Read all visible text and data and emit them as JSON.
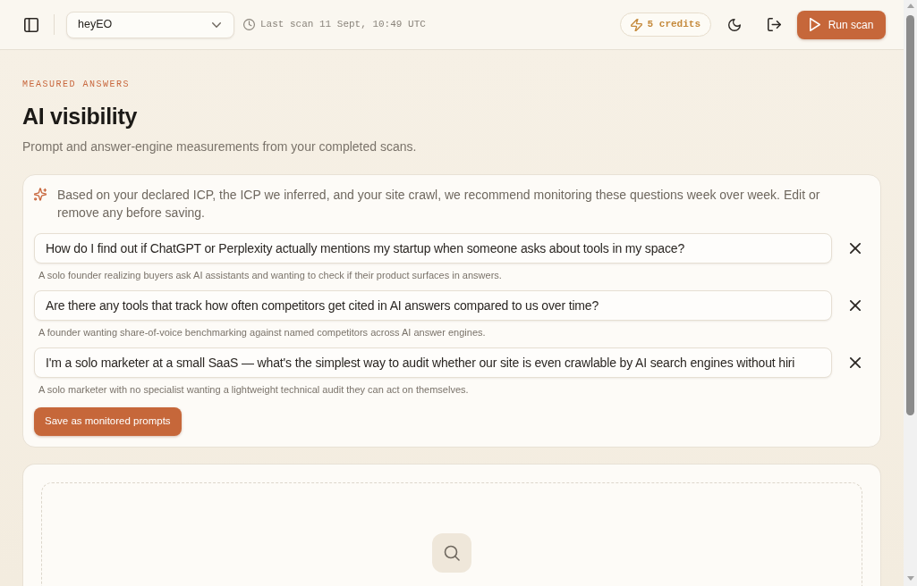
{
  "topbar": {
    "workspace": "heyEO",
    "last_scan": "Last scan 11 Sept, 10:49 UTC",
    "credits": "5 credits",
    "run_button": "Run scan"
  },
  "header": {
    "eyebrow": "MEASURED ANSWERS",
    "title": "AI visibility",
    "subtitle": "Prompt and answer-engine measurements from your completed scans."
  },
  "recommendations": {
    "intro": "Based on your declared ICP, the ICP we inferred, and your site crawl, we recommend monitoring these questions week over week. Edit or remove any before saving.",
    "prompts": [
      {
        "value": "How do I find out if ChatGPT or Perplexity actually mentions my startup when someone asks about tools in my space?",
        "hint": "A solo founder realizing buyers ask AI assistants and wanting to check if their product surfaces in answers."
      },
      {
        "value": "Are there any tools that track how often competitors get cited in AI answers compared to us over time?",
        "hint": "A founder wanting share-of-voice benchmarking against named competitors across AI answer engines."
      },
      {
        "value": "I'm a solo marketer at a small SaaS — what's the simplest way to audit whether our site is even crawlable by AI search engines without hiri",
        "hint": "A solo marketer with no specialist wanting a lightweight technical audit they can act on themselves."
      }
    ],
    "save_button": "Save as monitored prompts"
  }
}
